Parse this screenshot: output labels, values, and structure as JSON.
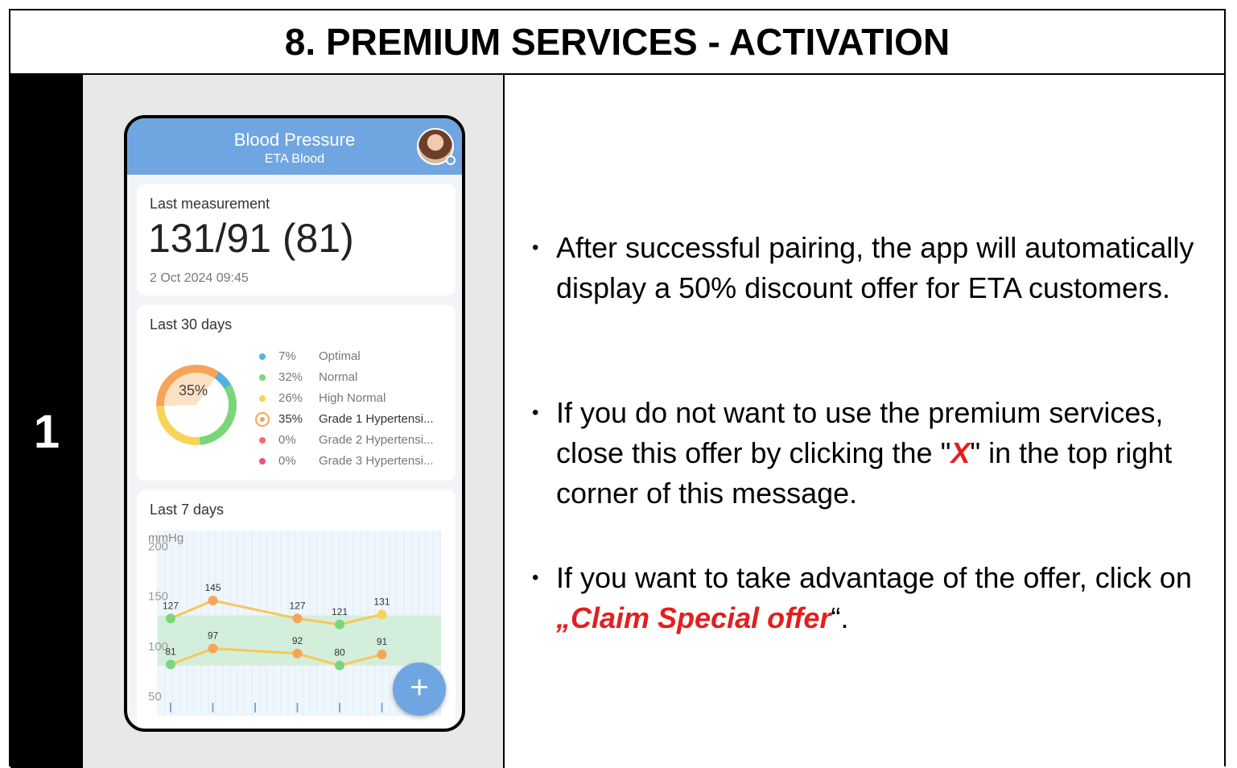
{
  "header": {
    "title": "8. PREMIUM SERVICES - ACTIVATION"
  },
  "step": {
    "number": "1"
  },
  "phone": {
    "app_title": "Blood Pressure",
    "app_subtitle": "ETA Blood",
    "last_measurement": {
      "label": "Last measurement",
      "value": "131/91 (81)",
      "date": "2 Oct 2024 09:45"
    },
    "last_30_days": {
      "label": "Last 30 days",
      "center_label": "35%",
      "legend": [
        {
          "pct": "7%",
          "name": "Optimal",
          "color": "#4fb3e0"
        },
        {
          "pct": "32%",
          "name": "Normal",
          "color": "#7bd67b"
        },
        {
          "pct": "26%",
          "name": "High Normal",
          "color": "#f7d357"
        },
        {
          "pct": "35%",
          "name": "Grade 1 Hypertensi...",
          "color": "#f7a45a",
          "selected": true
        },
        {
          "pct": "0%",
          "name": "Grade 2 Hypertensi...",
          "color": "#f26b6b"
        },
        {
          "pct": "0%",
          "name": "Grade 3 Hypertensi...",
          "color": "#ec4e8a"
        }
      ]
    },
    "last_7_days": {
      "label": "Last 7 days",
      "unit": "mmHg"
    },
    "fab_icon": "plus-icon"
  },
  "chart_data": {
    "type": "line",
    "ylabel": "mmHg",
    "ylim": [
      25,
      215
    ],
    "y_ticks": [
      "200",
      "150",
      "100",
      "50"
    ],
    "x_count": 7,
    "series": [
      {
        "values": [
          127,
          145,
          null,
          127,
          121,
          131
        ],
        "colors": [
          "green",
          "orange",
          null,
          "orange",
          "green",
          "yellow"
        ]
      },
      {
        "values": [
          81,
          97,
          null,
          92,
          80,
          91
        ],
        "colors": [
          "green",
          "orange",
          null,
          "orange",
          "green",
          "orange"
        ]
      }
    ],
    "normal_band": [
      [
        80,
        130
      ]
    ],
    "grid": true
  },
  "instructions": {
    "bullet1": "After successful pairing, the app will automatically display a 50% discount offer for ETA customers.",
    "bullet2_a": "If you do not want to use the premium services, close this offer by clicking the \"",
    "bullet2_b": "X",
    "bullet2_c": "\" in the top right corner of this message.",
    "bullet3_a": "If you want to take advantage of the offer, click on ",
    "bullet3_b": "„Claim Special offer",
    "bullet3_c": "“.",
    "bullet_char": "•"
  }
}
